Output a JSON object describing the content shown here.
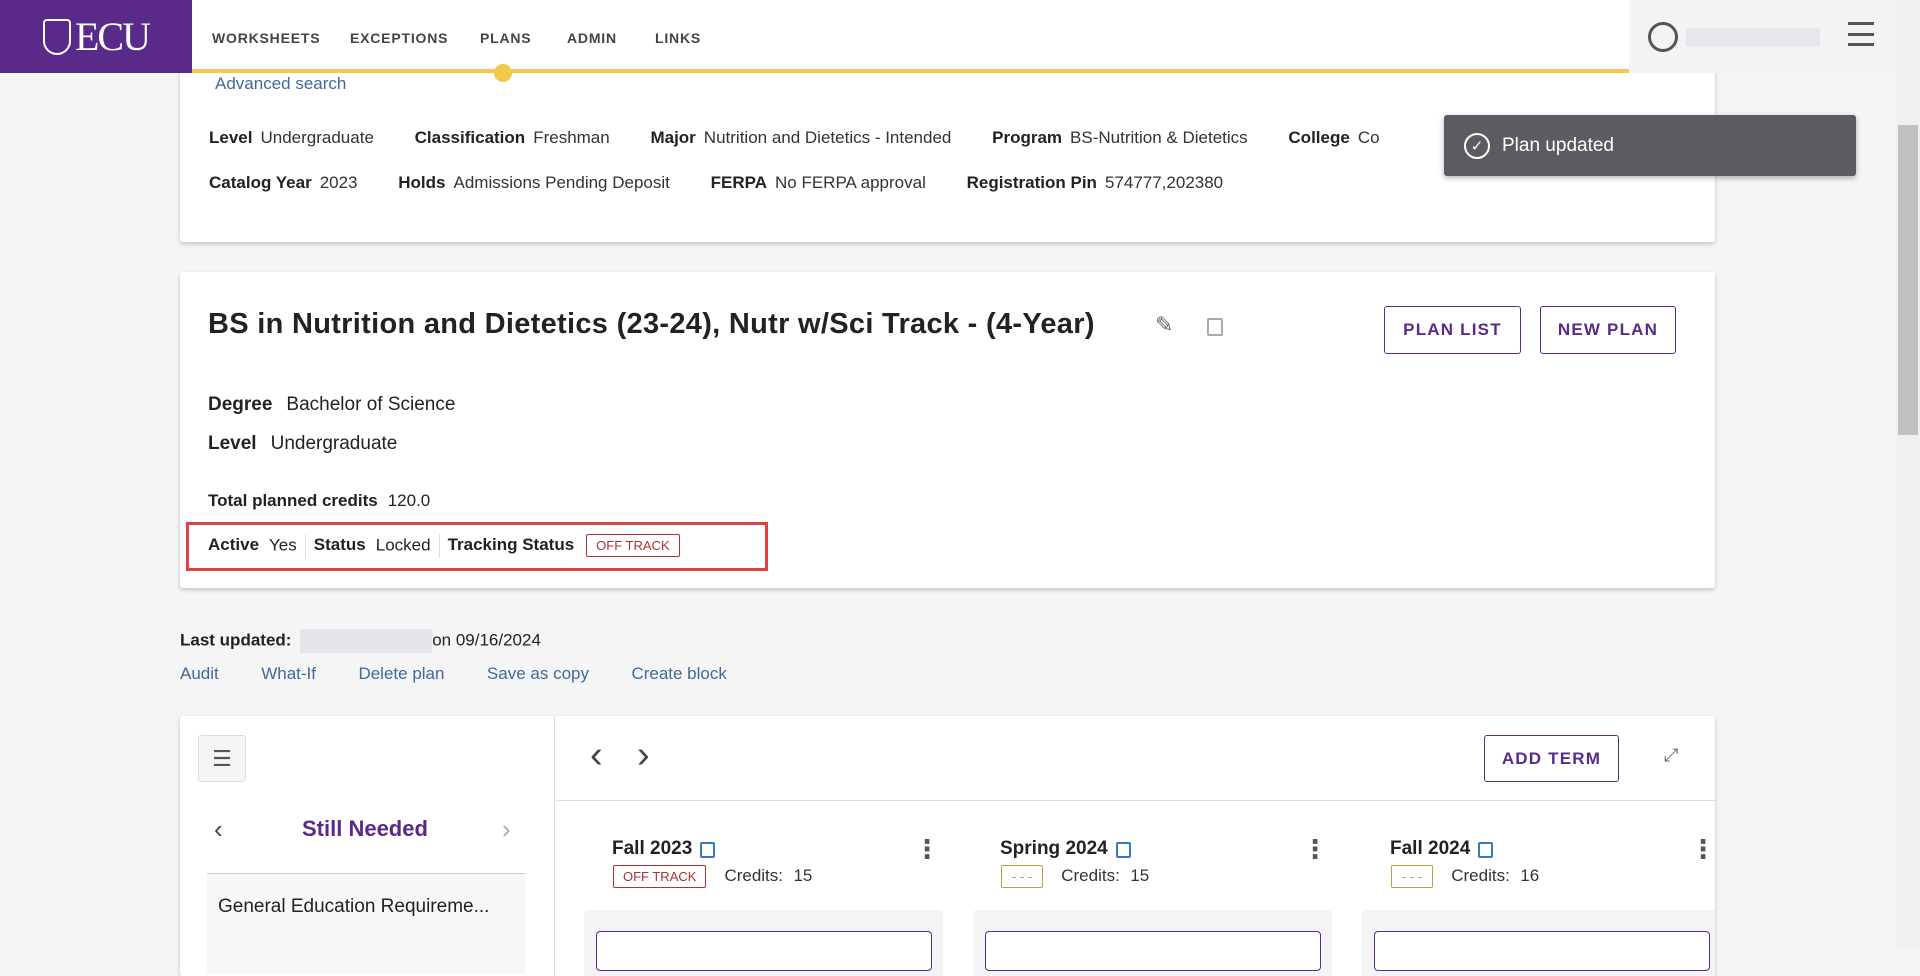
{
  "header": {
    "logo_text": "ECU",
    "nav": [
      "WORKSHEETS",
      "EXCEPTIONS",
      "PLANS",
      "ADMIN",
      "LINKS"
    ],
    "active_nav": "PLANS",
    "accent": "#592a8a",
    "highlight": "#f2c94c"
  },
  "student": {
    "advanced_search": "Advanced search",
    "row1": [
      {
        "label": "Level",
        "value": "Undergraduate"
      },
      {
        "label": "Classification",
        "value": "Freshman"
      },
      {
        "label": "Major",
        "value": "Nutrition and Dietetics - Intended"
      },
      {
        "label": "Program",
        "value": "BS-Nutrition & Dietetics"
      },
      {
        "label": "College",
        "value": "Co"
      }
    ],
    "row2": [
      {
        "label": "Catalog Year",
        "value": "2023"
      },
      {
        "label": "Holds",
        "value": "Admissions Pending Deposit"
      },
      {
        "label": "FERPA",
        "value": "No FERPA approval"
      },
      {
        "label": "Registration Pin",
        "value": "574777,202380"
      }
    ]
  },
  "toast": {
    "message": "Plan updated"
  },
  "plan": {
    "title": "BS in Nutrition and Dietetics (23-24), Nutr w/Sci Track - (4-Year)",
    "plan_list": "PLAN LIST",
    "new_plan": "NEW PLAN",
    "degree_label": "Degree",
    "degree": "Bachelor of Science",
    "level_label": "Level",
    "level": "Undergraduate",
    "credits_label": "Total planned credits",
    "credits": "120.0",
    "active_label": "Active",
    "active": "Yes",
    "status_label": "Status",
    "status": "Locked",
    "tracking_label": "Tracking Status",
    "tracking": "OFF TRACK"
  },
  "updated": {
    "label": "Last updated:",
    "date": "on 09/16/2024"
  },
  "actions": [
    "Audit",
    "What-If",
    "Delete plan",
    "Save as copy",
    "Create block"
  ],
  "board": {
    "panel_title": "Still Needed",
    "first_item": "General Education Requireme...",
    "add_term": "ADD TERM",
    "terms": [
      {
        "name": "Fall 2023",
        "badge": "OFF TRACK",
        "credits_label": "Credits:",
        "credits": "15"
      },
      {
        "name": "Spring 2024",
        "badge": "- - -",
        "credits_label": "Credits:",
        "credits": "15"
      },
      {
        "name": "Fall 2024",
        "badge": "- - -",
        "credits_label": "Credits:",
        "credits": "16"
      }
    ]
  }
}
